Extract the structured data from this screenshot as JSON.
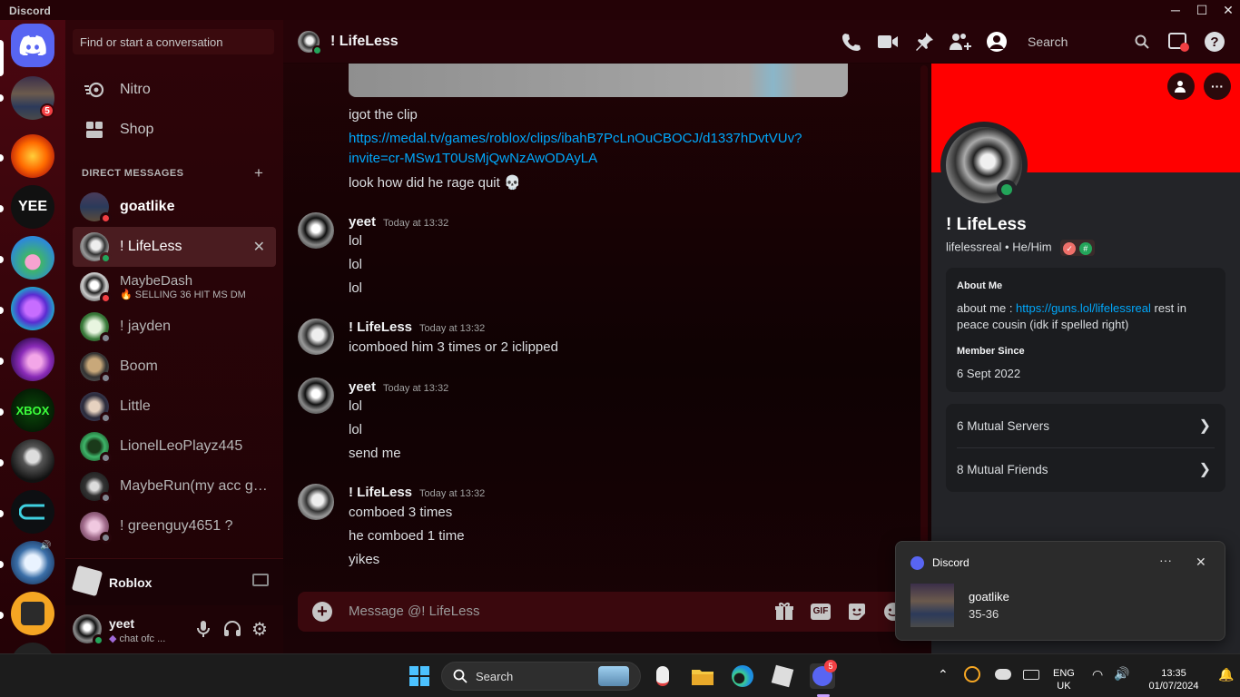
{
  "window": {
    "title": "Discord",
    "minimize": "─",
    "maximize": "☐",
    "close": "✕"
  },
  "servers": [
    {
      "badge": "5"
    }
  ],
  "dm_search": {
    "placeholder": "Find or start a conversation"
  },
  "nav": {
    "nitro": "Nitro",
    "shop": "Shop"
  },
  "direct_messages": {
    "header": "DIRECT MESSAGES",
    "add": "+",
    "items": [
      {
        "name": "goatlike"
      },
      {
        "name": "! LifeLess"
      },
      {
        "name": "MaybeDash",
        "status_text": "SELLING 36 HIT MS DM"
      },
      {
        "name": "! jayden"
      },
      {
        "name": "Boom"
      },
      {
        "name": "Little"
      },
      {
        "name": "LionelLeoPlayz445"
      },
      {
        "name": "MaybeRun(my acc got..."
      },
      {
        "name": "! greenguy4651 ?"
      }
    ]
  },
  "activity": {
    "game": "Roblox"
  },
  "user": {
    "name": "yeet",
    "status": "chat ofc ..."
  },
  "chat": {
    "channel": "! LifeLess",
    "header_search": "Search",
    "messages": [
      {
        "text": "igot the clip"
      },
      {
        "link": "https://medal.tv/games/roblox/clips/ibahB7PcLnOuCBOCJ/d1337hDvtVUv?invite=cr-MSw1T0UsMjQwNzAwODAyLA",
        "link_line1": "https://medal.tv/games/roblox/clips/ibahB7PcLnOuCBOCJ/d1337hDvtVUv?",
        "link_line2": "invite=cr-MSw1T0UsMjQwNzAwODAyLA"
      },
      {
        "text": "look how did he rage quit",
        "emoji": "💀"
      }
    ],
    "groups": [
      {
        "author": "yeet",
        "time": "Today at 13:32",
        "lines": [
          "lol",
          "lol",
          "lol"
        ]
      },
      {
        "author": "! LifeLess",
        "time": "Today at 13:32",
        "lines": [
          "icomboed him 3 times or 2 iclipped"
        ]
      },
      {
        "author": "yeet",
        "time": "Today at 13:32",
        "lines": [
          "lol",
          "lol",
          "send me"
        ]
      },
      {
        "author": "! LifeLess",
        "time": "Today at 13:32",
        "lines": [
          "comboed 3 times",
          "he comboed 1 time",
          "yikes"
        ]
      }
    ],
    "composer_placeholder": "Message @! LifeLess",
    "gif_label": "GIF"
  },
  "profile": {
    "display_name": "! LifeLess",
    "username": "lifelessreal",
    "pronouns": "He/Him",
    "about_label": "About Me",
    "about_prefix": "about me : ",
    "about_link": "https://guns.lol/lifelessreal",
    "about_line1_suffix": " rest in",
    "about_line2": "peace cousin (idk if spelled right)",
    "member_since_label": "Member Since",
    "member_since": "6 Sept 2022",
    "mutual_servers": "6 Mutual Servers",
    "mutual_friends": "8 Mutual Friends"
  },
  "notification": {
    "app": "Discord",
    "title": "goatlike",
    "body": "35-36"
  },
  "taskbar": {
    "search": "Search",
    "discord_badge": "5",
    "lang": "ENG",
    "region": "UK",
    "time": "13:35",
    "date": "01/07/2024"
  },
  "colors": {
    "accent": "#5865f2",
    "banner": "#ff0000",
    "online": "#23a55a",
    "dnd": "#f23f43",
    "link": "#00a8fc"
  }
}
